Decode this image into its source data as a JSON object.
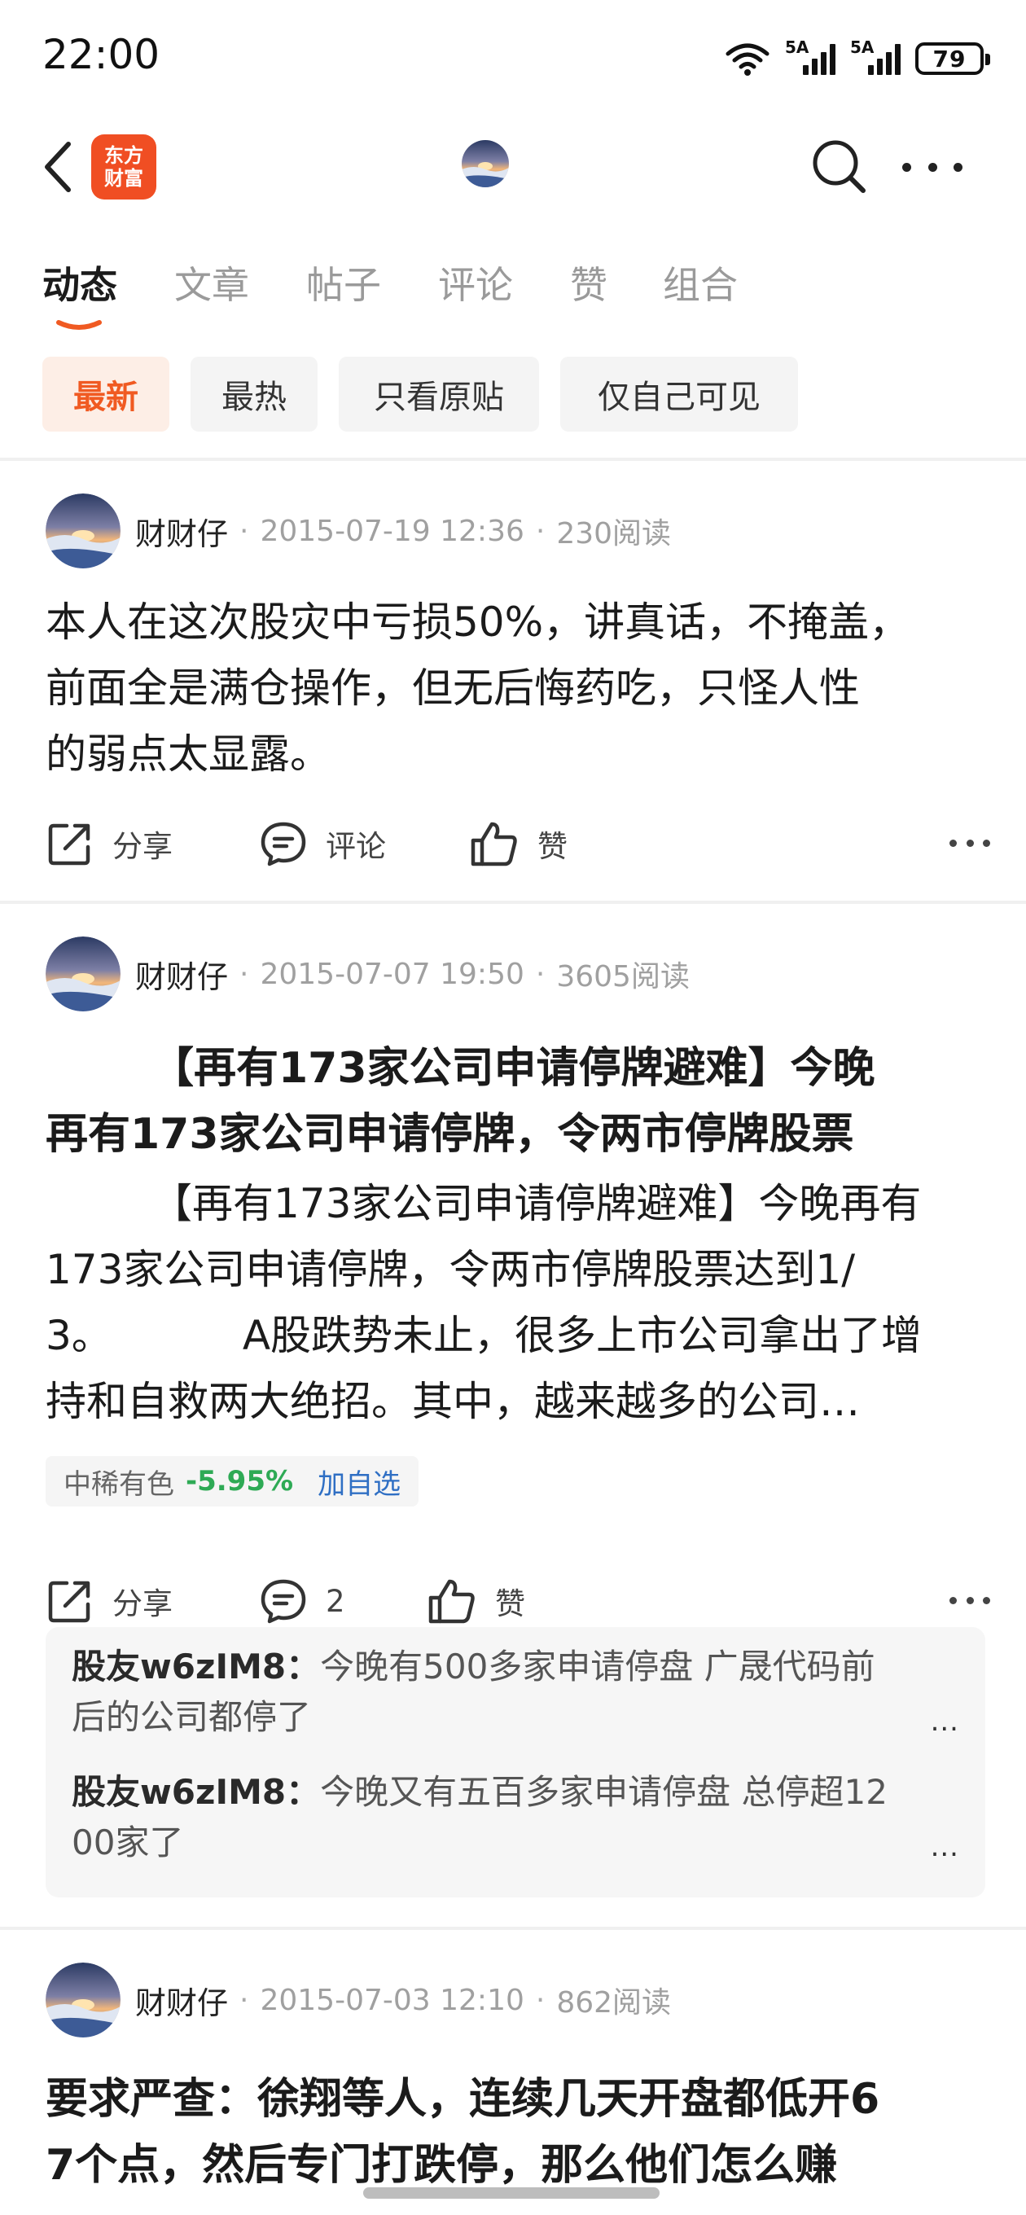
{
  "status_bar": {
    "time": "22:00",
    "signal_1_label": "5A",
    "signal_2_label": "5A",
    "battery": "79",
    "icons": [
      "wifi-icon",
      "cell-signal-icon",
      "cell-signal-icon",
      "battery-icon"
    ]
  },
  "nav": {
    "app_logo_line1": "东方",
    "app_logo_line2": "财富",
    "icons": [
      "chevron-left-icon",
      "avatar",
      "search-icon",
      "more-icon"
    ]
  },
  "tabs": [
    {
      "label": "动态",
      "active": true
    },
    {
      "label": "文章",
      "active": false
    },
    {
      "label": "帖子",
      "active": false
    },
    {
      "label": "评论",
      "active": false
    },
    {
      "label": "赞",
      "active": false
    },
    {
      "label": "组合",
      "active": false
    }
  ],
  "filters": [
    {
      "label": "最新",
      "active": true
    },
    {
      "label": "最热",
      "active": false
    },
    {
      "label": "只看原贴",
      "active": false
    },
    {
      "label": "仅自己可见",
      "active": false
    }
  ],
  "colors": {
    "accent": "#f05a22",
    "brand": "#f04e23",
    "stock_down": "#2eaa55",
    "link": "#2f6fc4"
  },
  "posts": [
    {
      "author": "财财仔",
      "date": "2015-07-19 12:36",
      "reads": "230阅读",
      "body_lines": [
        "本人在这次股灾中亏损50%，讲真话，不掩盖，",
        "前面全是满仓操作，但无后悔药吃，只怪人性",
        "的弱点太显露。"
      ],
      "actions": {
        "share": "分享",
        "comment": "评论",
        "like": "赞"
      }
    },
    {
      "author": "财财仔",
      "date": "2015-07-07 19:50",
      "reads": "3605阅读",
      "title_lines": [
        "【再有173家公司申请停牌避难】今晚",
        "再有173家公司申请停牌，令两市停牌股票"
      ],
      "body_lines": [
        "【再有173家公司申请停牌避难】今晚再有",
        "173家公司申请停牌，令两市停牌股票达到1/",
        "3。",
        "A股跌势未止，很多上市公司拿出了增",
        "持和自救两大绝招。其中，越来越多的公司…"
      ],
      "stock": {
        "name": "中稀有色",
        "change": "-5.95%",
        "add": "加自选"
      },
      "actions": {
        "share": "分享",
        "comment": "2",
        "like": "赞"
      },
      "comments": [
        {
          "user": "股友w6zIM8：",
          "line1": "今晚有500多家申请停盘 广晟代码前",
          "line2": "后的公司都停了",
          "more": "..."
        },
        {
          "user": "股友w6zIM8：",
          "line1": "今晚又有五百多家申请停盘 总停超12",
          "line2": "00家了",
          "more": "..."
        }
      ]
    },
    {
      "author": "财财仔",
      "date": "2015-07-03 12:10",
      "reads": "862阅读",
      "title_lines": [
        "要求严查：徐翔等人，连续几天开盘都低开6",
        "7个点，然后专门打跌停，那么他们怎么赚"
      ]
    }
  ]
}
